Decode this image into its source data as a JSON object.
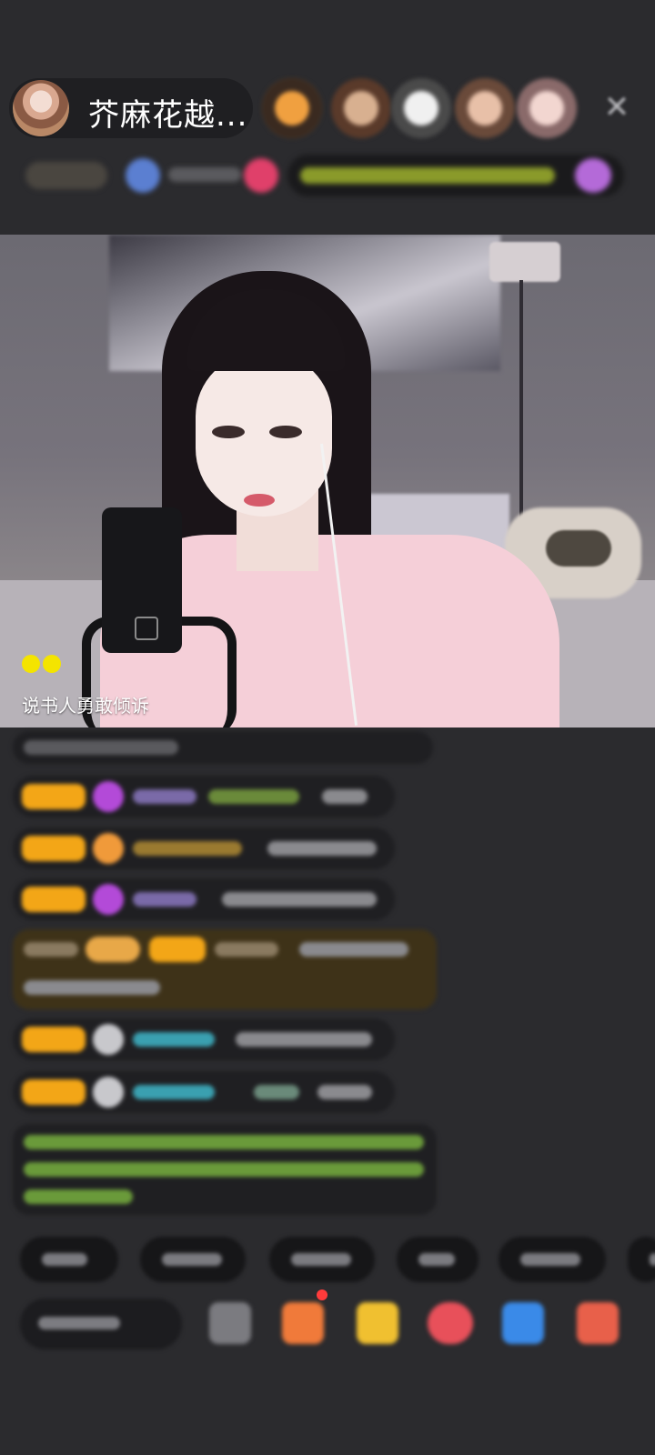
{
  "header": {
    "host_name": "芥麻花越...",
    "close_icon": "close-icon",
    "viewer_count": 5
  },
  "stage": {
    "caption": "说书人勇敢倾诉",
    "indicator_icon": "dual-dot-icon"
  },
  "colors": {
    "background": "#2b2b2e",
    "level_badge": "#f3a617",
    "caption_dot": "#f4e400",
    "notification": "#ff3b3b"
  },
  "chat": {
    "message_count": 9
  },
  "quick_tags": {
    "count": 6
  },
  "bottom_bar": {
    "actions": [
      "emoji-icon",
      "gift-box-icon",
      "treasure-icon",
      "red-packet-icon",
      "game-icon",
      "more-grid-icon"
    ]
  }
}
